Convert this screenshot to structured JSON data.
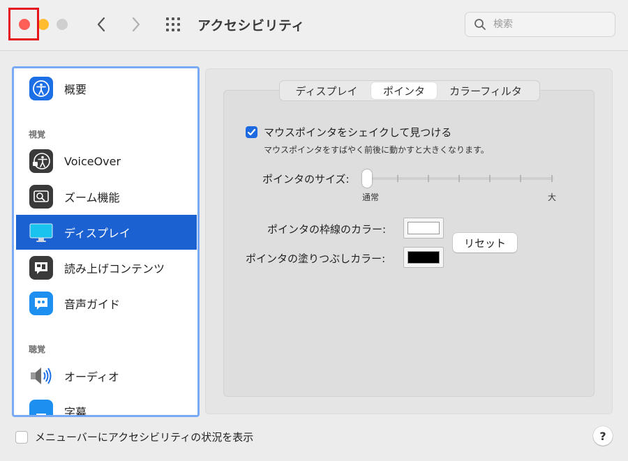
{
  "window": {
    "title": "アクセシビリティ",
    "search_placeholder": "検索"
  },
  "sidebar": {
    "items": [
      {
        "label": "概要",
        "icon": "accessibility-icon"
      },
      {
        "label": "VoiceOver",
        "icon": "voiceover-icon"
      },
      {
        "label": "ズーム機能",
        "icon": "zoom-icon"
      },
      {
        "label": "ディスプレイ",
        "icon": "display-icon",
        "selected": true
      },
      {
        "label": "読み上げコンテンツ",
        "icon": "spoken-content-icon"
      },
      {
        "label": "音声ガイド",
        "icon": "descriptions-icon"
      },
      {
        "label": "オーディオ",
        "icon": "speaker-icon"
      },
      {
        "label": "字幕",
        "icon": "captions-icon"
      }
    ],
    "headers": {
      "vision": "視覚",
      "hearing": "聴覚"
    }
  },
  "tabs": [
    {
      "label": "ディスプレイ"
    },
    {
      "label": "ポインタ",
      "selected": true
    },
    {
      "label": "カラーフィルタ"
    }
  ],
  "pointer": {
    "shake_label": "マウスポインタをシェイクして見つける",
    "shake_checked": true,
    "shake_desc": "マウスポインタをすばやく前後に動かすと大きくなります。",
    "size_label": "ポインタのサイズ:",
    "size_min_label": "通常",
    "size_max_label": "大",
    "size_value": 0,
    "outline_label": "ポインタの枠線のカラー:",
    "outline_color": "#ffffff",
    "fill_label": "ポインタの塗りつぶしカラー:",
    "fill_color": "#000000",
    "reset_label": "リセット"
  },
  "footer": {
    "menubar_label": "メニューバーにアクセシビリティの状況を表示",
    "menubar_checked": false,
    "help_label": "?"
  },
  "colors": {
    "accent": "#1b61d1",
    "highlight_border": "#e5131b"
  }
}
